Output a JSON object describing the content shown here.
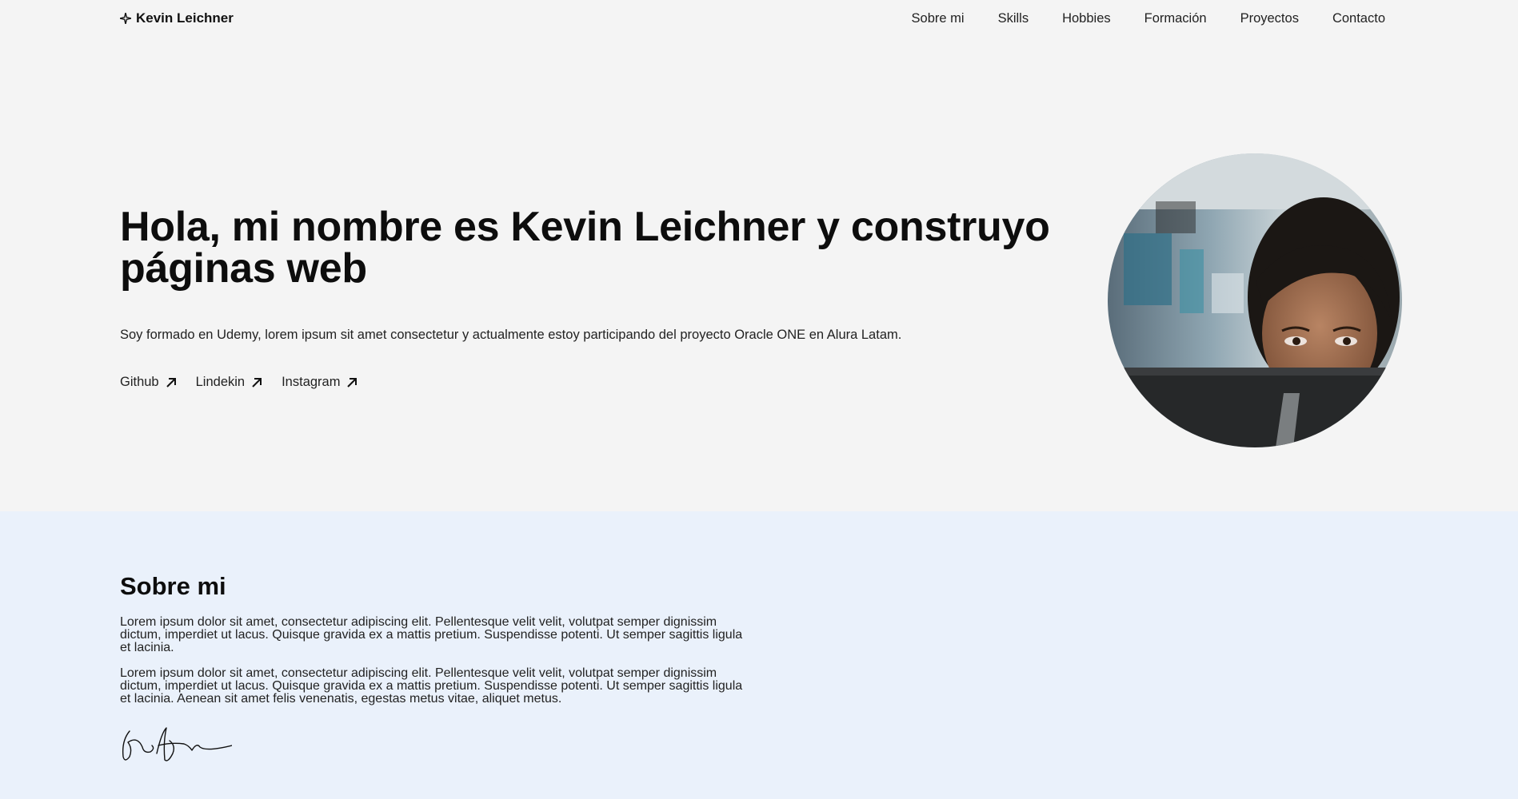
{
  "header": {
    "brand": "Kevin Leichner",
    "brand_icon": "sparkle-icon",
    "menu": [
      "Sobre mi",
      "Skills",
      "Hobbies",
      "Formación",
      "Proyectos",
      "Contacto"
    ]
  },
  "hero": {
    "title": "Hola, mi nombre es Kevin Leichner y construyo páginas web",
    "description": "Soy formado en Udemy, lorem ipsum sit amet consectetur y actualmente estoy participando del proyecto Oracle ONE en Alura Latam.",
    "links": [
      {
        "label": "Github",
        "icon": "arrow-up-right-icon"
      },
      {
        "label": "Lindekin",
        "icon": "arrow-up-right-icon"
      },
      {
        "label": "Instagram",
        "icon": "arrow-up-right-icon"
      }
    ],
    "image": "profile-photo"
  },
  "about": {
    "title": "Sobre mi",
    "paragraphs": [
      "Lorem ipsum dolor sit amet, consectetur adipiscing elit. Pellentesque velit velit, volutpat semper dignissim dictum, imperdiet ut lacus. Quisque gravida ex a mattis pretium. Suspendisse potenti. Ut semper sagittis ligula et lacinia.",
      "Lorem ipsum dolor sit amet, consectetur adipiscing elit. Pellentesque velit velit, volutpat semper dignissim dictum, imperdiet ut lacus. Quisque gravida ex a mattis pretium. Suspendisse potenti. Ut semper sagittis ligula et lacinia. Aenean sit amet felis venenatis, egestas metus vitae, aliquet metus."
    ],
    "signature": "signature-image"
  },
  "colors": {
    "page_bg": "#f4f4f4",
    "about_bg": "#eaf1fb",
    "text": "#111111"
  }
}
